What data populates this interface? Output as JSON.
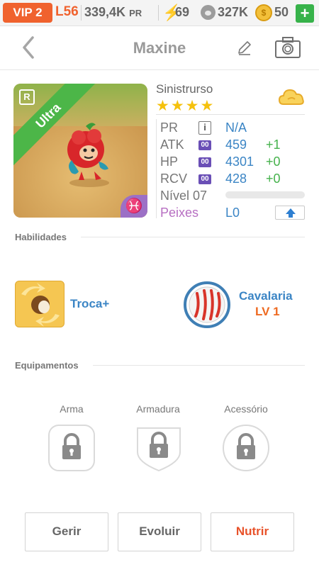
{
  "status_bar": {
    "vip": "VIP 2",
    "level": "L56",
    "pr_value": "339,4K",
    "pr_unit": "PR",
    "stamina": "69",
    "food": "327K",
    "coins": "50",
    "coin_glyph": "$",
    "add_label": "+"
  },
  "header": {
    "title": "Maxine"
  },
  "monster": {
    "name": "Sinistrurso",
    "rarity_ribbon": "Ultra",
    "rank_badge": "R",
    "zodiac_symbol": "♓",
    "stars": "★★★★",
    "element_icon": "cloud-icon"
  },
  "stats": {
    "pr_label": "PR",
    "pr_value": "N/A",
    "info_glyph": "i",
    "badge": "00",
    "atk_label": "ATK",
    "atk_value": "459",
    "atk_bonus": "+1",
    "hp_label": "HP",
    "hp_value": "4301",
    "hp_bonus": "+0",
    "rcv_label": "RCV",
    "rcv_value": "428",
    "rcv_bonus": "+0",
    "level_label": "Nível 07",
    "xp_progress": 0,
    "peixes_label": "Peixes",
    "peixes_value": "L0"
  },
  "skills": {
    "section_title": "Habilidades",
    "skill1_name": "Troca+",
    "skill2_name": "Cavalaria",
    "skill2_level": "LV 1"
  },
  "equipment": {
    "section_title": "Equipamentos",
    "weapon": "Arma",
    "armor": "Armadura",
    "accessory": "Acessório"
  },
  "actions": {
    "manage": "Gerir",
    "evolve": "Evoluir",
    "feed": "Nutrir"
  },
  "colors": {
    "accent_orange": "#f0622e",
    "link_blue": "#3b85c5",
    "bonus_green": "#45b24c",
    "ribbon_green": "#4cb648",
    "peixes_purple": "#b76fc2",
    "feed_red": "#e8522a"
  }
}
